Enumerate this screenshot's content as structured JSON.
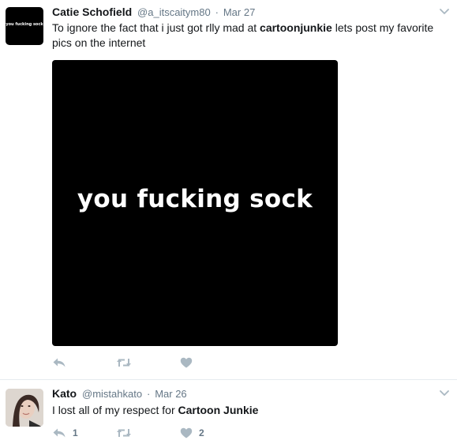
{
  "tweets": [
    {
      "display_name": "Catie Schofield",
      "handle": "@a_itscaitym80",
      "separator": "·",
      "date": "Mar 27",
      "avatar_text": "you fucking sock",
      "text_before": "To ignore the fact that i just got rlly mad at ",
      "text_bold": "cartoonjunkie",
      "text_after": " lets post my favorite pics on the internet",
      "media_text": "you fucking sock",
      "reply_count": "",
      "retweet_count": "",
      "like_count": ""
    },
    {
      "display_name": "Kato",
      "handle": "@mistahkato",
      "separator": "·",
      "date": "Mar 26",
      "text_before": "I lost all of my respect for ",
      "text_bold": "Cartoon Junkie",
      "text_after": "",
      "reply_count": "1",
      "retweet_count": "",
      "like_count": "2"
    }
  ],
  "icons": {
    "reply": "reply-icon",
    "retweet": "retweet-icon",
    "like": "heart-icon",
    "menu": "chevron-down-icon"
  },
  "colors": {
    "icon": "#aab8c2",
    "secondary_text": "#657786",
    "primary_text": "#14171a",
    "divider": "#e6ecf0"
  }
}
